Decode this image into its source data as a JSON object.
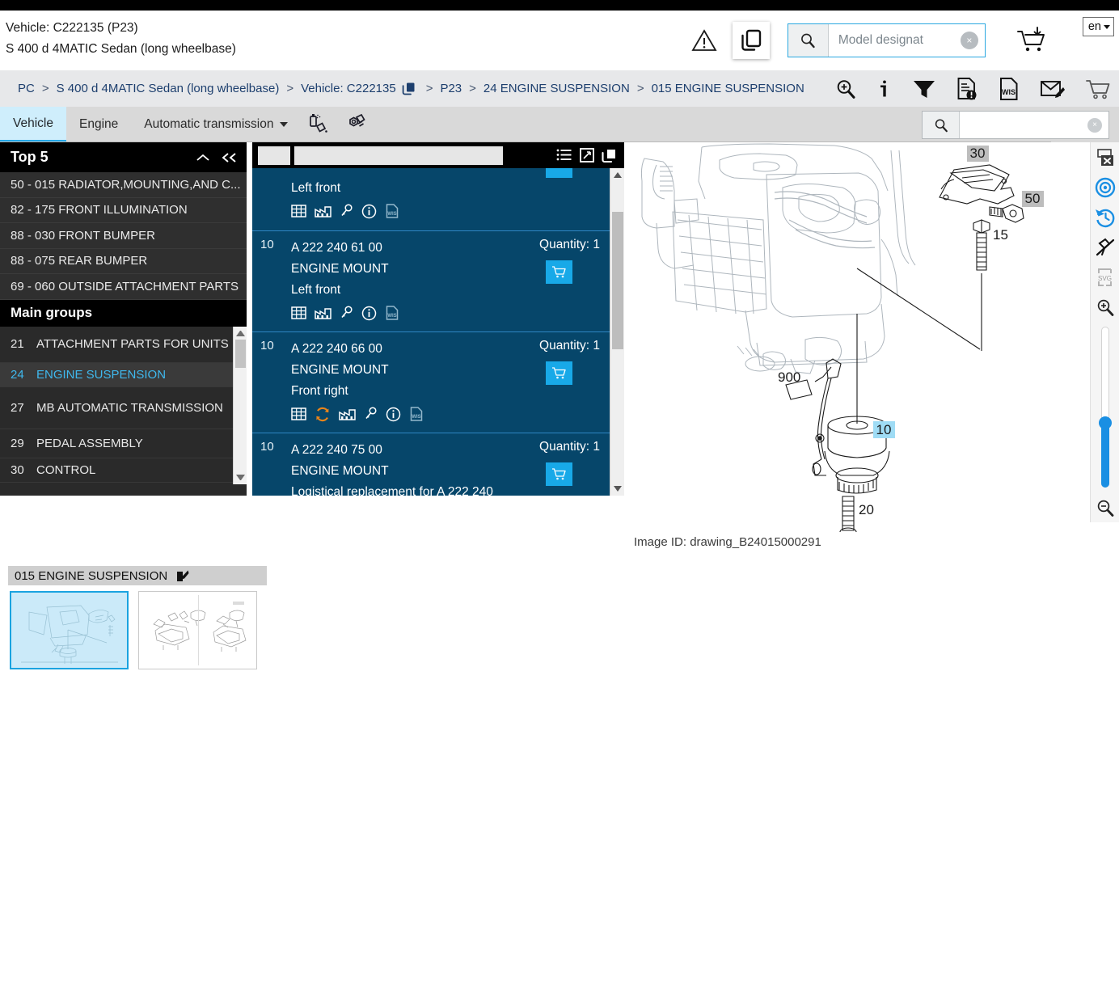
{
  "header": {
    "vehicle_line": "Vehicle: C222135 (P23)",
    "model_line": "S 400 d 4MATIC Sedan (long wheelbase)",
    "warning_icon": "warning-triangle-icon",
    "copy_icon": "copy-icon",
    "search": {
      "placeholder": "Model designat",
      "value": "",
      "icon": "search-icon",
      "clear": "×"
    },
    "cart_icon": "add-to-cart-icon",
    "language": {
      "value": "en",
      "caret": "chevron-down-icon"
    }
  },
  "breadcrumb": {
    "items": [
      "PC",
      "S 400 d 4MATIC Sedan (long wheelbase)",
      "Vehicle: C222135",
      "P23",
      "24 ENGINE SUSPENSION",
      "015 ENGINE SUSPENSION"
    ],
    "separator": ">",
    "tools": [
      "zoom-in-icon",
      "info-icon",
      "filter-icon",
      "document-alert-icon",
      "wis-document-icon",
      "mail-edit-icon",
      "cart-icon"
    ]
  },
  "tabs": {
    "items": [
      {
        "label": "Vehicle",
        "active": true
      },
      {
        "label": "Engine",
        "active": false
      },
      {
        "label": "Automatic transmission",
        "active": false,
        "has_caret": true
      }
    ],
    "icons": [
      "paint-spray-icon",
      "nut-and-bolt-icon"
    ],
    "search": {
      "value": "",
      "placeholder": "",
      "icon": "search-icon",
      "clear": "×"
    }
  },
  "left_panel": {
    "top5": {
      "title": "Top 5",
      "collapse_icon": "chevron-up-icon",
      "collapse_all_icon": "double-chevron-left-icon",
      "items": [
        "50 - 015 RADIATOR,MOUNTING,AND C...",
        "82 - 175 FRONT ILLUMINATION",
        "88 - 030 FRONT BUMPER",
        "88 - 075 REAR BUMPER",
        "69 - 060 OUTSIDE ATTACHMENT PARTS"
      ]
    },
    "main_groups": {
      "title": "Main groups",
      "items": [
        {
          "num": "21",
          "label": "ATTACHMENT PARTS FOR UNITS",
          "selected": false
        },
        {
          "num": "24",
          "label": "ENGINE SUSPENSION",
          "selected": true
        },
        {
          "num": "27",
          "label": "MB AUTOMATIC TRANSMISSION",
          "selected": false
        },
        {
          "num": "29",
          "label": "PEDAL ASSEMBLY",
          "selected": false
        },
        {
          "num": "30",
          "label": "CONTROL",
          "selected": false
        }
      ]
    }
  },
  "parts_panel": {
    "toolbar_icons": [
      "list-view-icon",
      "expand-icon",
      "copy-icon"
    ],
    "quantity_label": "Quantity:",
    "cart_icon": "add-to-cart-icon",
    "rows": [
      {
        "idx": "",
        "part_number": "",
        "description": "",
        "sub": "Left front",
        "quantity": "",
        "partial": true,
        "icons": [
          "table-icon",
          "factory-icon",
          "key-icon",
          "info-icon",
          "wis-icon"
        ]
      },
      {
        "idx": "10",
        "part_number": "A 222 240 61 00",
        "description": "ENGINE MOUNT",
        "sub": "Left front",
        "quantity": "1",
        "partial": false,
        "icons": [
          "table-icon",
          "factory-icon",
          "key-icon",
          "info-icon",
          "wis-icon"
        ]
      },
      {
        "idx": "10",
        "part_number": "A 222 240 66 00",
        "description": "ENGINE MOUNT",
        "sub": "Front right",
        "quantity": "1",
        "partial": false,
        "icons": [
          "table-icon",
          "refresh-icon",
          "factory-icon",
          "key-icon",
          "info-icon",
          "wis-icon"
        ]
      },
      {
        "idx": "10",
        "part_number": "A 222 240 75 00",
        "description": "ENGINE MOUNT",
        "sub": "Logistical replacement for A 222 240",
        "quantity": "1",
        "partial": false,
        "icons": []
      }
    ]
  },
  "drawing": {
    "image_id": "Image ID: drawing_B24015000291",
    "callouts": [
      {
        "label": "30",
        "style": "gray"
      },
      {
        "label": "50",
        "style": "gray"
      },
      {
        "label": "15",
        "style": "plain"
      },
      {
        "label": "900",
        "style": "plain"
      },
      {
        "label": "10",
        "style": "highlight"
      },
      {
        "label": "20",
        "style": "plain"
      }
    ],
    "tools": [
      "close-panel-icon",
      "target-icon",
      "history-undo-icon",
      "unpin-icon",
      "svg-export-icon",
      "zoom-in-icon",
      "zoom-slider",
      "zoom-out-icon"
    ],
    "zoom_value": 40
  },
  "thumbnails": {
    "title": "015 ENGINE SUSPENSION",
    "edit_icon": "edit-icon",
    "items": [
      {
        "name": "thumb-1",
        "selected": true
      },
      {
        "name": "thumb-2",
        "selected": false
      }
    ]
  },
  "colors": {
    "accent_blue": "#18a9e8",
    "parts_bg": "#06466a",
    "crumb_text": "#1d3f6e",
    "tab_active": "#cfeefc"
  }
}
